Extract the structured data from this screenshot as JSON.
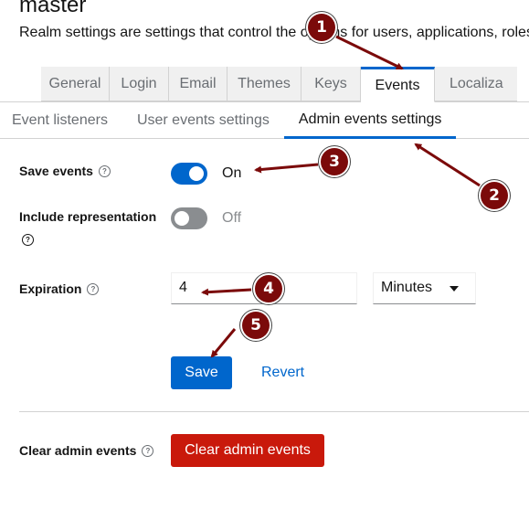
{
  "header": {
    "title": "master",
    "subtitle": "Realm settings are settings that control the options for users, applications, roles"
  },
  "tabs": [
    {
      "label": "General",
      "active": false
    },
    {
      "label": "Login",
      "active": false
    },
    {
      "label": "Email",
      "active": false
    },
    {
      "label": "Themes",
      "active": false
    },
    {
      "label": "Keys",
      "active": false
    },
    {
      "label": "Events",
      "active": true
    },
    {
      "label": "Localiza",
      "active": false
    }
  ],
  "subtabs": [
    {
      "label": "Event listeners",
      "active": false
    },
    {
      "label": "User events settings",
      "active": false
    },
    {
      "label": "Admin events settings",
      "active": true
    }
  ],
  "form": {
    "save_events": {
      "label": "Save events",
      "state": "On",
      "enabled": true
    },
    "include_representation": {
      "label": "Include representation",
      "state": "Off",
      "enabled": false
    },
    "expiration": {
      "label": "Expiration",
      "value": "4",
      "unit": "Minutes"
    },
    "save_label": "Save",
    "revert_label": "Revert",
    "clear": {
      "label": "Clear admin events",
      "button_label": "Clear admin events"
    }
  },
  "help_icon_glyph": "?",
  "annotations": [
    "1",
    "2",
    "3",
    "4",
    "5"
  ],
  "colors": {
    "primary": "#0066cc",
    "danger": "#c9190b",
    "annotation": "#7b0a0a"
  }
}
